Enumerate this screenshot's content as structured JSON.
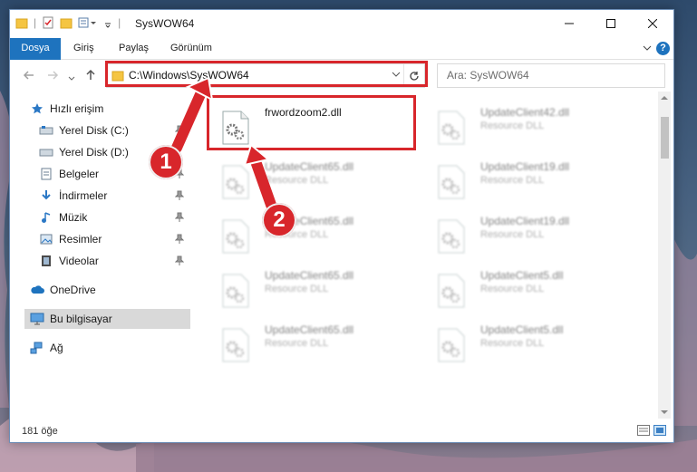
{
  "window": {
    "title": "SysWOW64"
  },
  "ribbon": {
    "tabs": [
      "Dosya",
      "Giriş",
      "Paylaş",
      "Görünüm"
    ],
    "help": "?"
  },
  "nav": {
    "address": "C:\\Windows\\SysWOW64",
    "search_placeholder": "Ara: SysWOW64"
  },
  "sidebar": {
    "quick_access": "Hızlı erişim",
    "items": [
      {
        "label": "Yerel Disk (C:)",
        "icon": "drive-icon",
        "pinned": true
      },
      {
        "label": "Yerel Disk (D:)",
        "icon": "drive-icon",
        "pinned": false
      },
      {
        "label": "Belgeler",
        "icon": "documents-icon",
        "pinned": true
      },
      {
        "label": "İndirmeler",
        "icon": "download-icon",
        "pinned": true
      },
      {
        "label": "Müzik",
        "icon": "music-icon",
        "pinned": true
      },
      {
        "label": "Resimler",
        "icon": "pictures-icon",
        "pinned": true
      },
      {
        "label": "Videolar",
        "icon": "video-icon",
        "pinned": true
      }
    ],
    "onedrive": "OneDrive",
    "this_pc": "Bu bilgisayar",
    "network": "Ağ"
  },
  "files": {
    "highlighted": {
      "name": "frwordzoom2.dll",
      "type": ""
    },
    "left_column": [
      {
        "name": "UpdateClient65.dll",
        "type": "Resource DLL"
      },
      {
        "name": "UpdateClient65.dll",
        "type": "Resource DLL"
      },
      {
        "name": "UpdateClient65.dll",
        "type": "Resource DLL"
      },
      {
        "name": "UpdateClient65.dll",
        "type": "Resource DLL"
      }
    ],
    "right_column": [
      {
        "name": "UpdateClient42.dll",
        "type": "Resource DLL"
      },
      {
        "name": "UpdateClient19.dll",
        "type": "Resource DLL"
      },
      {
        "name": "UpdateClient19.dll",
        "type": "Resource DLL"
      },
      {
        "name": "UpdateClient5.dll",
        "type": "Resource DLL"
      },
      {
        "name": "UpdateClient5.dll",
        "type": "Resource DLL"
      }
    ]
  },
  "status": {
    "count": "181 öğe"
  },
  "callouts": [
    "1",
    "2"
  ],
  "colors": {
    "accent": "#1e73be",
    "highlight": "#d8262b"
  }
}
